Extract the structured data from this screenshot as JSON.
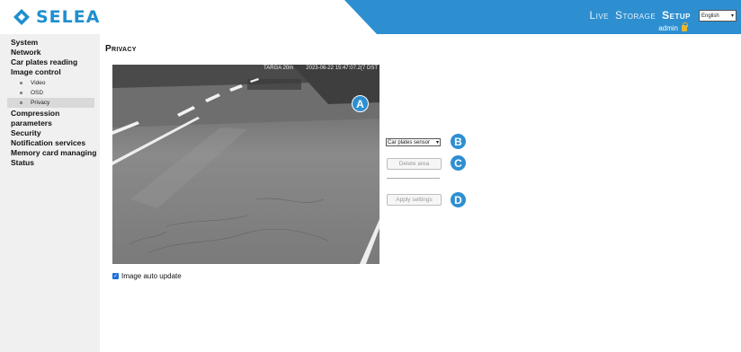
{
  "brand": {
    "name": "SELEA",
    "color": "#1e8fd0"
  },
  "header": {
    "accent": "#2e8fd0",
    "nav": [
      {
        "label": "Live",
        "active": false
      },
      {
        "label": "Storage",
        "active": false
      },
      {
        "label": "Setup",
        "active": true
      }
    ],
    "language": "English",
    "user": "admin"
  },
  "sidebar": {
    "items": [
      {
        "label": "System"
      },
      {
        "label": "Network"
      },
      {
        "label": "Car plates reading"
      },
      {
        "label": "Image control"
      }
    ],
    "sub_items": [
      {
        "label": "Video"
      },
      {
        "label": "OSD"
      },
      {
        "label": "Privacy",
        "active": true
      }
    ],
    "items_after": [
      {
        "label": "Compression parameters"
      },
      {
        "label": "Security"
      },
      {
        "label": "Notification services"
      },
      {
        "label": "Memory card managing"
      },
      {
        "label": "Status"
      }
    ]
  },
  "main": {
    "title": "Privacy",
    "camera_overlay": {
      "left": "TARGA 20m",
      "timestamp": "2023-06-22 15:47:07.2(7 DST"
    },
    "badges": [
      "A",
      "B",
      "C",
      "D"
    ],
    "sensor_select": {
      "value": "Car plates sensor"
    },
    "delete_button": "Delete area",
    "apply_button": "Apply settings",
    "auto_update": {
      "label": "Image auto update",
      "checked": true
    }
  }
}
